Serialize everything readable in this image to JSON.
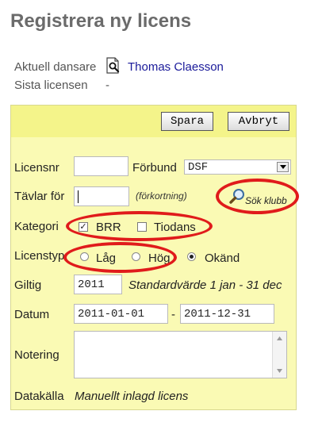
{
  "page": {
    "title": "Registrera ny licens"
  },
  "info": {
    "current_dancer_label": "Aktuell dansare",
    "current_dancer_name": "Thomas Claesson",
    "last_license_label": "Sista licensen",
    "last_license_value": "-"
  },
  "toolbar": {
    "save_label": "Spara",
    "cancel_label": "Avbryt"
  },
  "form": {
    "license_no_label": "Licensnr",
    "license_no_value": "",
    "federation_label": "Förbund",
    "federation_value": "DSF",
    "competes_for_label": "Tävlar för",
    "competes_for_value": "",
    "abbrev_hint": "(förkortning)",
    "search_club_label": "Sök klubb",
    "category_label": "Kategori",
    "category_options": [
      {
        "label": "BRR",
        "checked": true
      },
      {
        "label": "Tiodans",
        "checked": false
      }
    ],
    "license_type_label": "Licenstyp",
    "license_type_options": [
      {
        "label": "Låg",
        "selected": false
      },
      {
        "label": "Hög",
        "selected": false
      },
      {
        "label": "Okänd",
        "selected": true
      }
    ],
    "valid_label": "Giltig",
    "valid_value": "2011",
    "valid_hint": "Standardvärde 1 jan - 31 dec",
    "date_label": "Datum",
    "date_from": "2011-01-01",
    "date_separator": "-",
    "date_to": "2011-12-31",
    "note_label": "Notering",
    "note_value": "",
    "source_label": "Datakälla",
    "source_value": "Manuellt inlagd licens"
  },
  "colors": {
    "panel_bg": "#fafab4",
    "toolbar_bg": "#f4f48a",
    "annotation": "#e01b1b"
  }
}
